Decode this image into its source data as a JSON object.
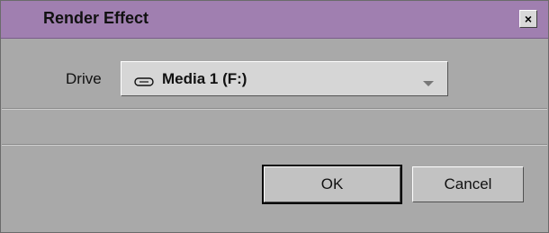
{
  "dialog": {
    "title": "Render Effect",
    "close_label": "×"
  },
  "drive": {
    "label": "Drive",
    "selected_value": "Media 1 (F:)",
    "icon": "drive-icon"
  },
  "buttons": {
    "ok_label": "OK",
    "cancel_label": "Cancel"
  },
  "colors": {
    "titlebar": "#a07fb0",
    "background": "#a9a9a9"
  }
}
